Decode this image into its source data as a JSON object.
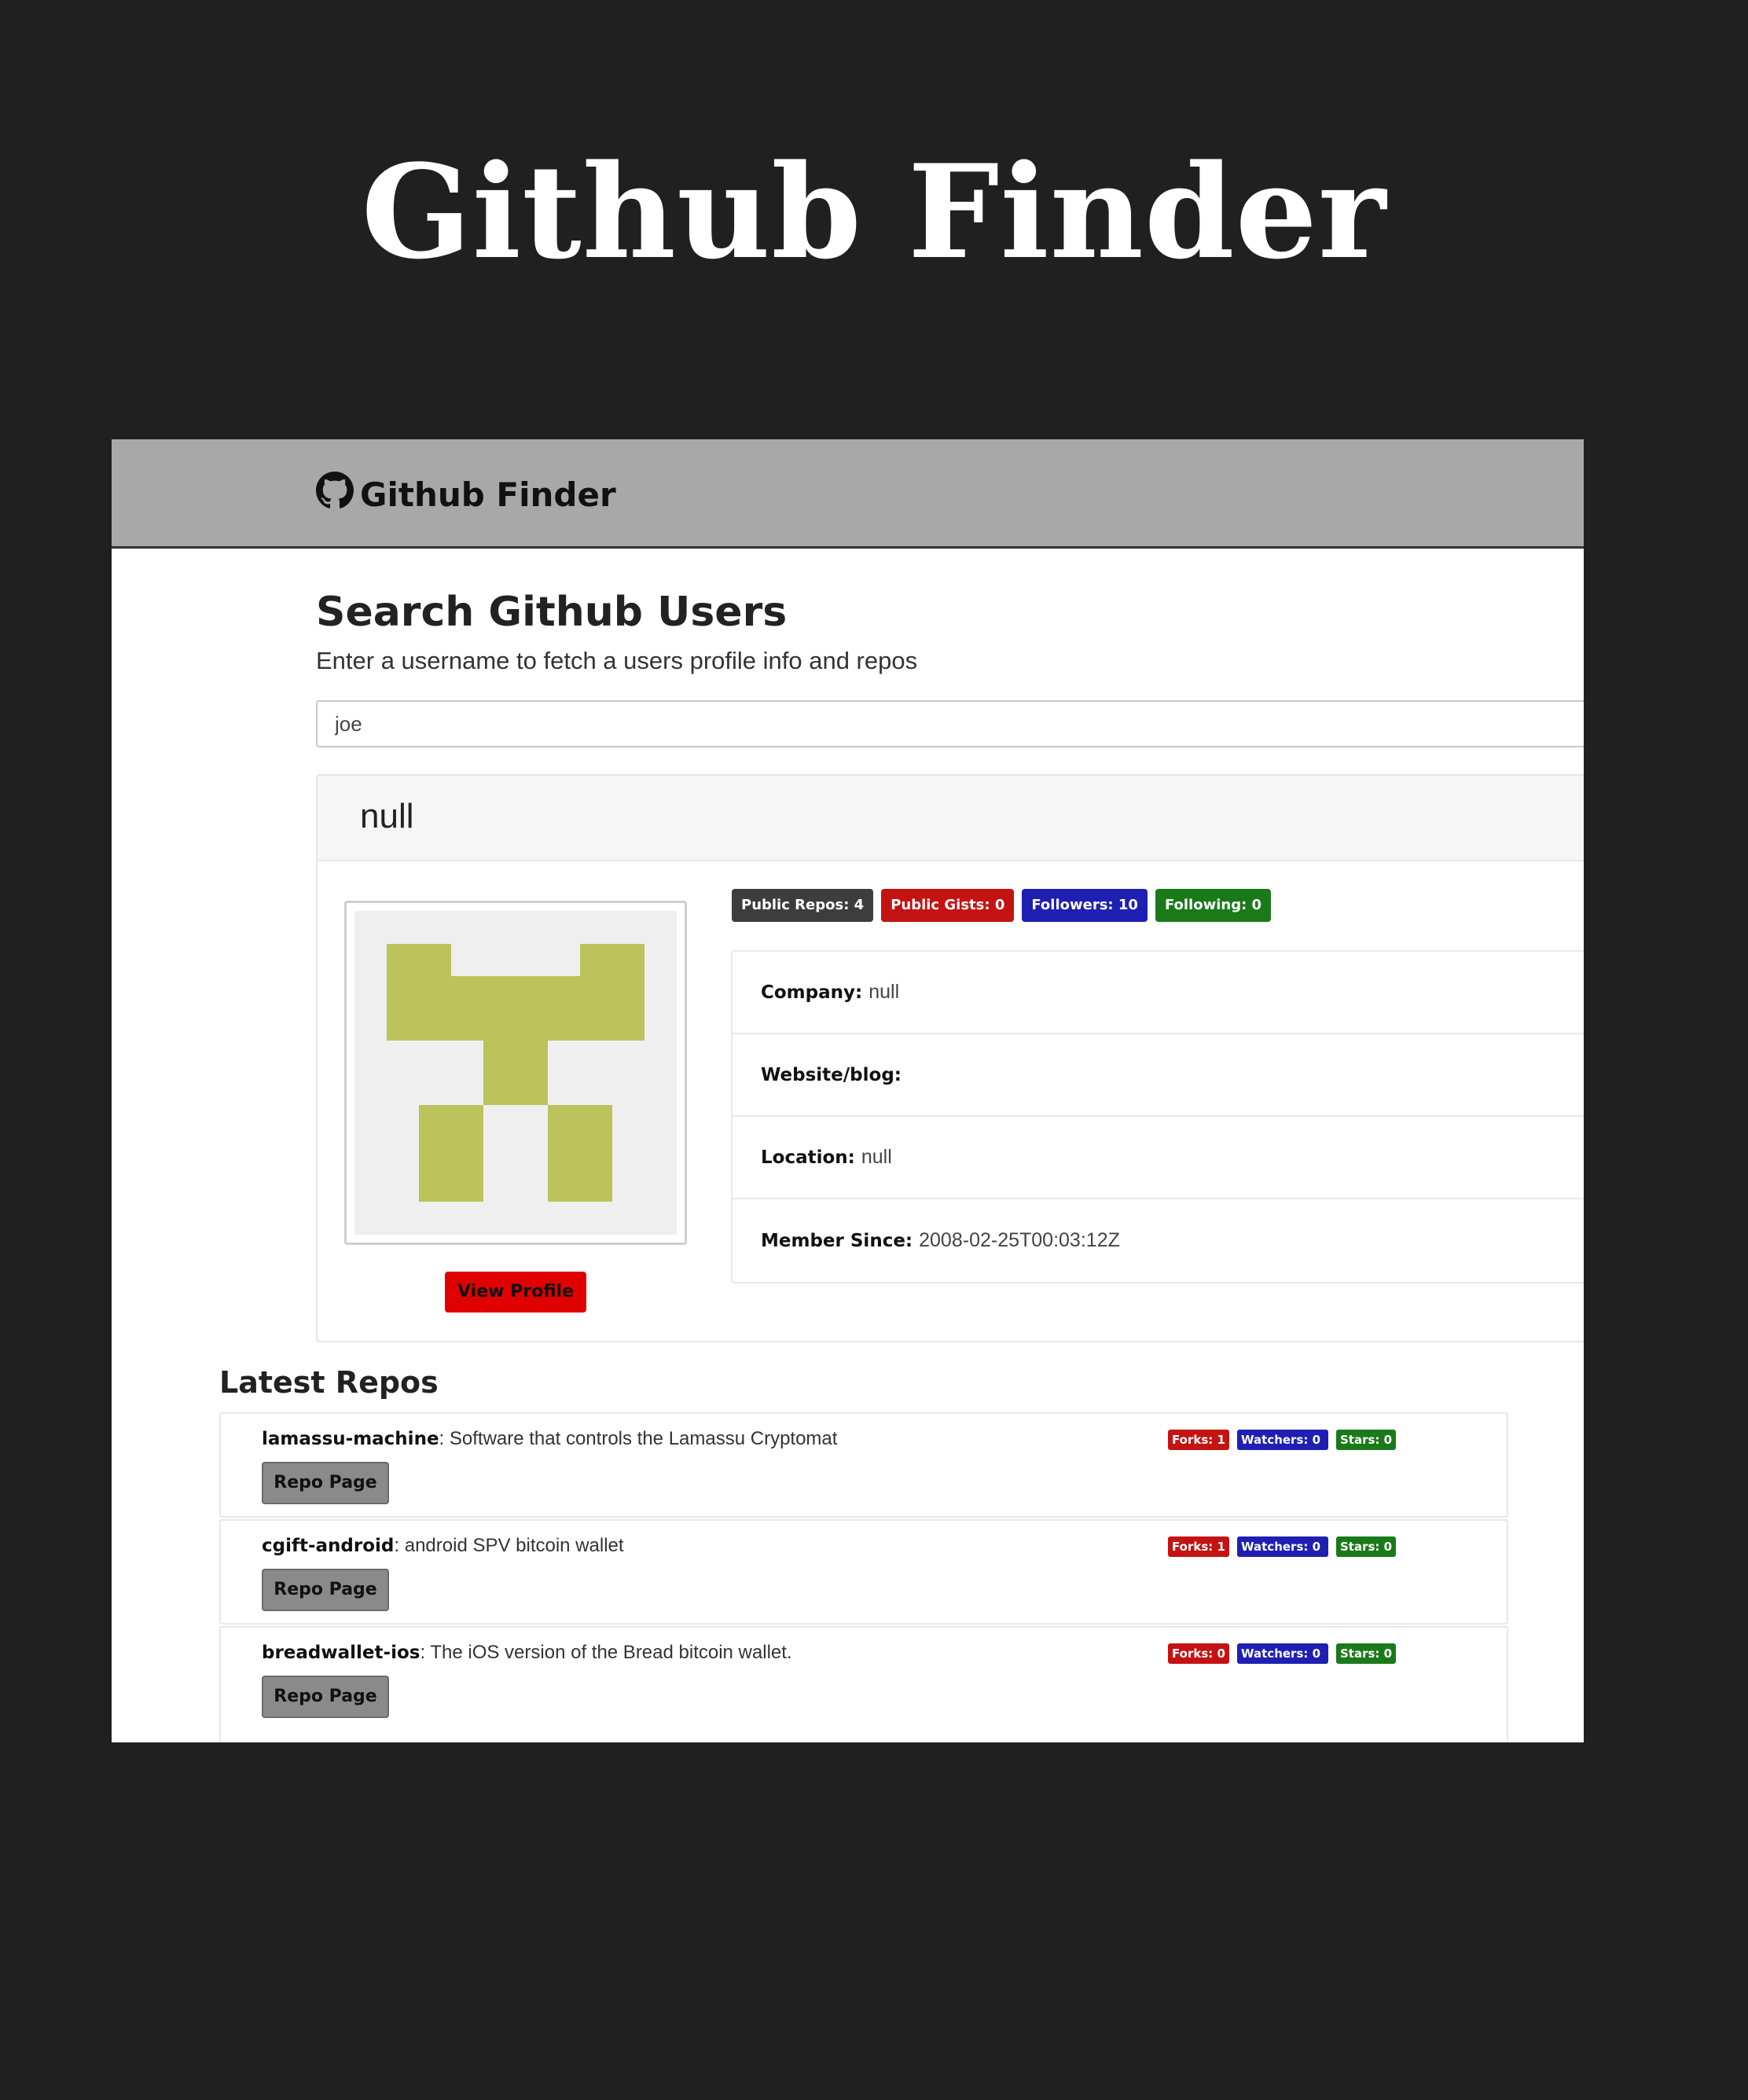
{
  "hero": {
    "title": "Github Finder"
  },
  "navbar": {
    "brand": "Github Finder",
    "brand_icon": "github-icon"
  },
  "search": {
    "heading": "Search Github Users",
    "lead": "Enter a username to fetch a users profile info and repos",
    "value": "joe"
  },
  "profile": {
    "name": "null",
    "view_profile_label": "View Profile",
    "badges": [
      {
        "label": "Public Repos: 4",
        "color": "#3d3d3d"
      },
      {
        "label": "Public Gists: 0",
        "color": "#c41313"
      },
      {
        "label": "Followers: 10",
        "color": "#1f1fb3"
      },
      {
        "label": "Following: 0",
        "color": "#1a7a1a"
      }
    ],
    "info": [
      {
        "label": "Company:",
        "value": "null"
      },
      {
        "label": "Website/blog:",
        "value": ""
      },
      {
        "label": "Location:",
        "value": "null"
      },
      {
        "label": "Member Since:",
        "value": "2008-02-25T00:03:12Z"
      }
    ],
    "avatar_color": "#bcc35a"
  },
  "repos": {
    "heading": "Latest Repos",
    "button_label": "Repo Page",
    "items": [
      {
        "name": "lamassu-machine",
        "description": ": Software that controls the Lamassu Cryptomat",
        "forks": "Forks: 1",
        "watchers": "Watchers: 0",
        "stars": "Stars: 0"
      },
      {
        "name": "cgift-android",
        "description": ": android SPV bitcoin wallet",
        "forks": "Forks: 1",
        "watchers": "Watchers: 0",
        "stars": "Stars: 0"
      },
      {
        "name": "breadwallet-ios",
        "description": ": The iOS version of the Bread bitcoin wallet.",
        "forks": "Forks: 0",
        "watchers": "Watchers: 0",
        "stars": "Stars: 0"
      }
    ]
  }
}
